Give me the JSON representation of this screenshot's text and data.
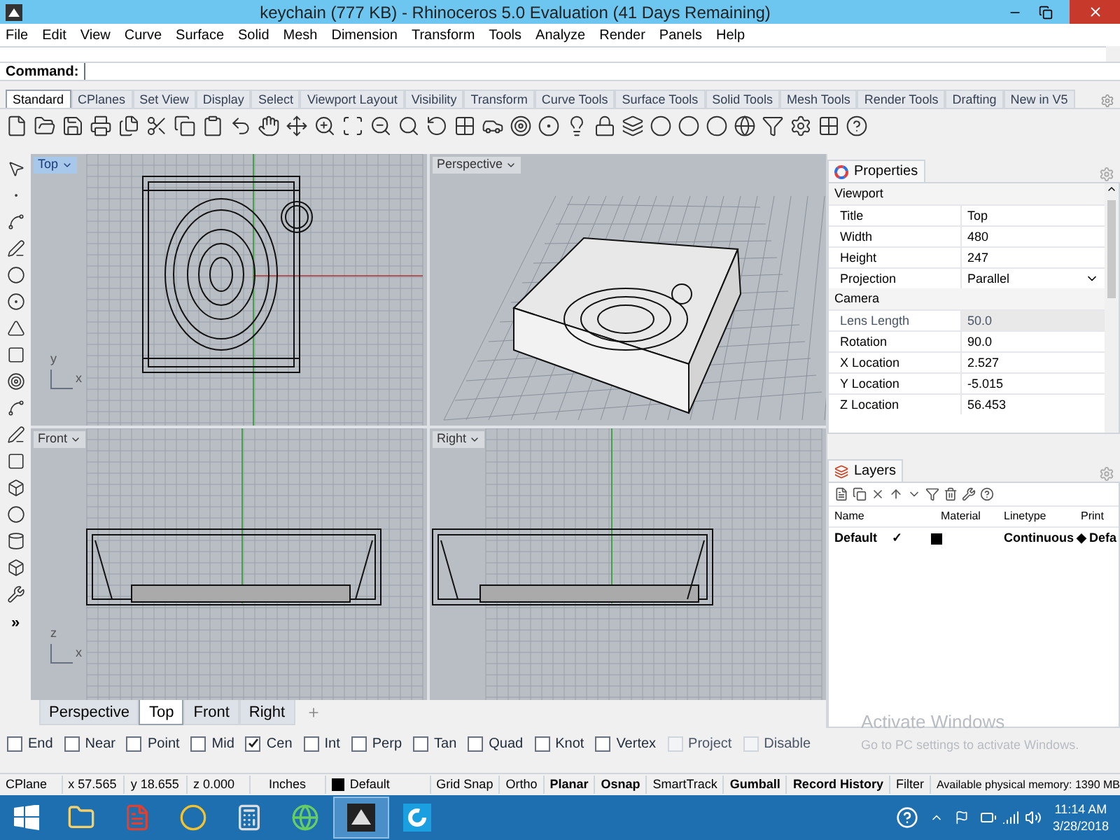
{
  "window": {
    "title": "keychain (777 KB) - Rhinoceros 5.0 Evaluation (41 Days Remaining)"
  },
  "menu": [
    "File",
    "Edit",
    "View",
    "Curve",
    "Surface",
    "Solid",
    "Mesh",
    "Dimension",
    "Transform",
    "Tools",
    "Analyze",
    "Render",
    "Panels",
    "Help"
  ],
  "command": {
    "label": "Command:"
  },
  "toolbar_tabs": [
    {
      "label": "Standard",
      "selected": true
    },
    {
      "label": "CPlanes",
      "selected": false
    },
    {
      "label": "Set View",
      "selected": false
    },
    {
      "label": "Display",
      "selected": false
    },
    {
      "label": "Select",
      "selected": false
    },
    {
      "label": "Viewport Layout",
      "selected": false
    },
    {
      "label": "Visibility",
      "selected": false
    },
    {
      "label": "Transform",
      "selected": false
    },
    {
      "label": "Curve Tools",
      "selected": false
    },
    {
      "label": "Surface Tools",
      "selected": false
    },
    {
      "label": "Solid Tools",
      "selected": false
    },
    {
      "label": "Mesh Tools",
      "selected": false
    },
    {
      "label": "Render Tools",
      "selected": false
    },
    {
      "label": "Drafting",
      "selected": false
    },
    {
      "label": "New in V5",
      "selected": false
    }
  ],
  "viewports": [
    {
      "label": "Top",
      "kind": "top",
      "active": true,
      "axes": [
        "y",
        "x"
      ]
    },
    {
      "label": "Perspective",
      "kind": "perspective",
      "active": false
    },
    {
      "label": "Front",
      "kind": "front",
      "active": false,
      "axes": [
        "z",
        "x"
      ]
    },
    {
      "label": "Right",
      "kind": "right",
      "active": false
    }
  ],
  "toolbox_more": "»",
  "viewport_tabs": [
    {
      "label": "Perspective",
      "selected": false
    },
    {
      "label": "Top",
      "selected": true
    },
    {
      "label": "Front",
      "selected": false
    },
    {
      "label": "Right",
      "selected": false
    }
  ],
  "properties": {
    "title": "Properties",
    "rows": [
      {
        "kind": "section",
        "label": "Viewport"
      },
      {
        "kind": "row",
        "label": "Title",
        "value": "Top",
        "disabled": false
      },
      {
        "kind": "row",
        "label": "Width",
        "value": "480",
        "disabled": false
      },
      {
        "kind": "row",
        "label": "Height",
        "value": "247",
        "disabled": false
      },
      {
        "kind": "select",
        "label": "Projection",
        "value": "Parallel",
        "disabled": false
      },
      {
        "kind": "section",
        "label": "Camera"
      },
      {
        "kind": "row",
        "label": "Lens Length",
        "value": "50.0",
        "disabled": true
      },
      {
        "kind": "row",
        "label": "Rotation",
        "value": "90.0",
        "disabled": false
      },
      {
        "kind": "row",
        "label": "X Location",
        "value": "2.527",
        "disabled": false
      },
      {
        "kind": "row",
        "label": "Y Location",
        "value": "-5.015",
        "disabled": false
      },
      {
        "kind": "row",
        "label": "Z Location",
        "value": "56.453",
        "disabled": false
      }
    ]
  },
  "layers": {
    "title": "Layers",
    "columns": [
      "Name",
      "Material",
      "Linetype",
      "Print "
    ],
    "rows": [
      {
        "name": "Default",
        "current": "✓",
        "color": "#000000",
        "linetype": "Continuous",
        "print_mark": "◆",
        "print": "Defa"
      }
    ]
  },
  "osnaps": [
    {
      "label": "End",
      "checked": false,
      "disabled": false
    },
    {
      "label": "Near",
      "checked": false,
      "disabled": false
    },
    {
      "label": "Point",
      "checked": false,
      "disabled": false
    },
    {
      "label": "Mid",
      "checked": false,
      "disabled": false
    },
    {
      "label": "Cen",
      "checked": true,
      "disabled": false
    },
    {
      "label": "Int",
      "checked": false,
      "disabled": false
    },
    {
      "label": "Perp",
      "checked": false,
      "disabled": false
    },
    {
      "label": "Tan",
      "checked": false,
      "disabled": false
    },
    {
      "label": "Quad",
      "checked": false,
      "disabled": false
    },
    {
      "label": "Knot",
      "checked": false,
      "disabled": false
    },
    {
      "label": "Vertex",
      "checked": false,
      "disabled": false
    },
    {
      "label": "Project",
      "checked": false,
      "disabled": true
    },
    {
      "label": "Disable",
      "checked": false,
      "disabled": true
    }
  ],
  "activation": {
    "title": "Activate Windows",
    "text": "Go to PC settings to activate Windows."
  },
  "status_bar": {
    "fields": [
      "CPlane",
      "x 57.565",
      "y 18.655",
      "z 0.000",
      "Inches"
    ],
    "layer": {
      "label": "Default",
      "color": "#000000"
    },
    "toggles": [
      {
        "label": "Grid Snap",
        "on": false
      },
      {
        "label": "Ortho",
        "on": false
      },
      {
        "label": "Planar",
        "on": true
      },
      {
        "label": "Osnap",
        "on": true
      },
      {
        "label": "SmartTrack",
        "on": false
      },
      {
        "label": "Gumball",
        "on": true
      },
      {
        "label": "Record History",
        "on": true
      },
      {
        "label": "Filter",
        "on": false
      }
    ],
    "memory": "Available physical memory: 1390 MB"
  },
  "taskbar": {
    "apps": [
      {
        "kind": "folder",
        "selected": false
      },
      {
        "kind": "pdf",
        "selected": false
      },
      {
        "kind": "browser",
        "selected": false
      },
      {
        "kind": "calculator",
        "selected": false
      },
      {
        "kind": "globe",
        "selected": false
      },
      {
        "kind": "rhino",
        "selected": true
      },
      {
        "kind": "letter",
        "selected": false
      }
    ],
    "time": "11:14 AM",
    "date": "3/28/2018"
  }
}
